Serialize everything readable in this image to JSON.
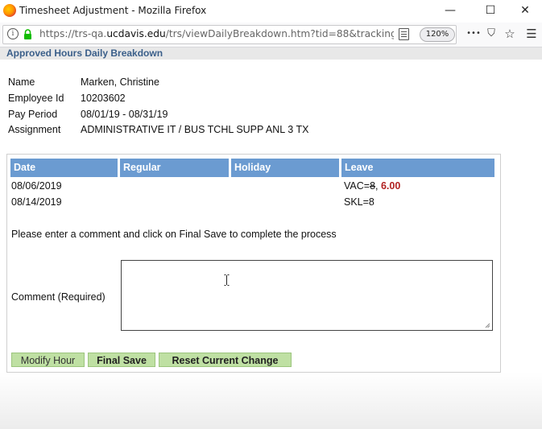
{
  "window": {
    "title": "Timesheet Adjustment - Mozilla Firefox",
    "minimize_glyph": "—",
    "maximize_glyph": "☐",
    "close_glyph": "✕"
  },
  "navbar": {
    "url_prefix": "https://trs-qa.",
    "url_domain": "ucdavis.edu",
    "url_path": "/trs/viewDailyBreakdown.htm?tid=88&tracking_id=",
    "zoom": "120%",
    "more_glyph": "•••",
    "pocket_glyph": "⛉",
    "bookmark_glyph": "☆",
    "menu_glyph": "☰",
    "info_glyph": "i"
  },
  "page": {
    "header": "Approved Hours Daily Breakdown",
    "employee": {
      "name_label": "Name",
      "name": "Marken, Christine",
      "id_label": "Employee Id",
      "id": "10203602",
      "period_label": "Pay Period",
      "period": "08/01/19 - 08/31/19",
      "assignment_label": "Assignment",
      "assignment": "ADMINISTRATIVE IT / BUS TCHL SUPP ANL 3 TX"
    },
    "table": {
      "headers": [
        "Date",
        "Regular",
        "Holiday",
        "Leave"
      ],
      "rows": [
        {
          "date": "08/06/2019",
          "leave_prefix": "VAC=",
          "leave_old": "8",
          "leave_sep": ", ",
          "leave_new": "6.00"
        },
        {
          "date": "08/14/2019",
          "leave": "SKL=8"
        }
      ]
    },
    "instruction": "Please enter a comment and click on Final Save to complete the process",
    "comment_label": "Comment (Required)",
    "comment_value": "",
    "buttons": {
      "modify": "Modify Hour",
      "final_save": "Final Save",
      "reset": "Reset Current Change"
    }
  },
  "colors": {
    "header_text": "#3b5f8a",
    "table_header_bg": "#6b9bd1",
    "button_bg": "#bfe0a3",
    "changed_value": "#b22222"
  }
}
